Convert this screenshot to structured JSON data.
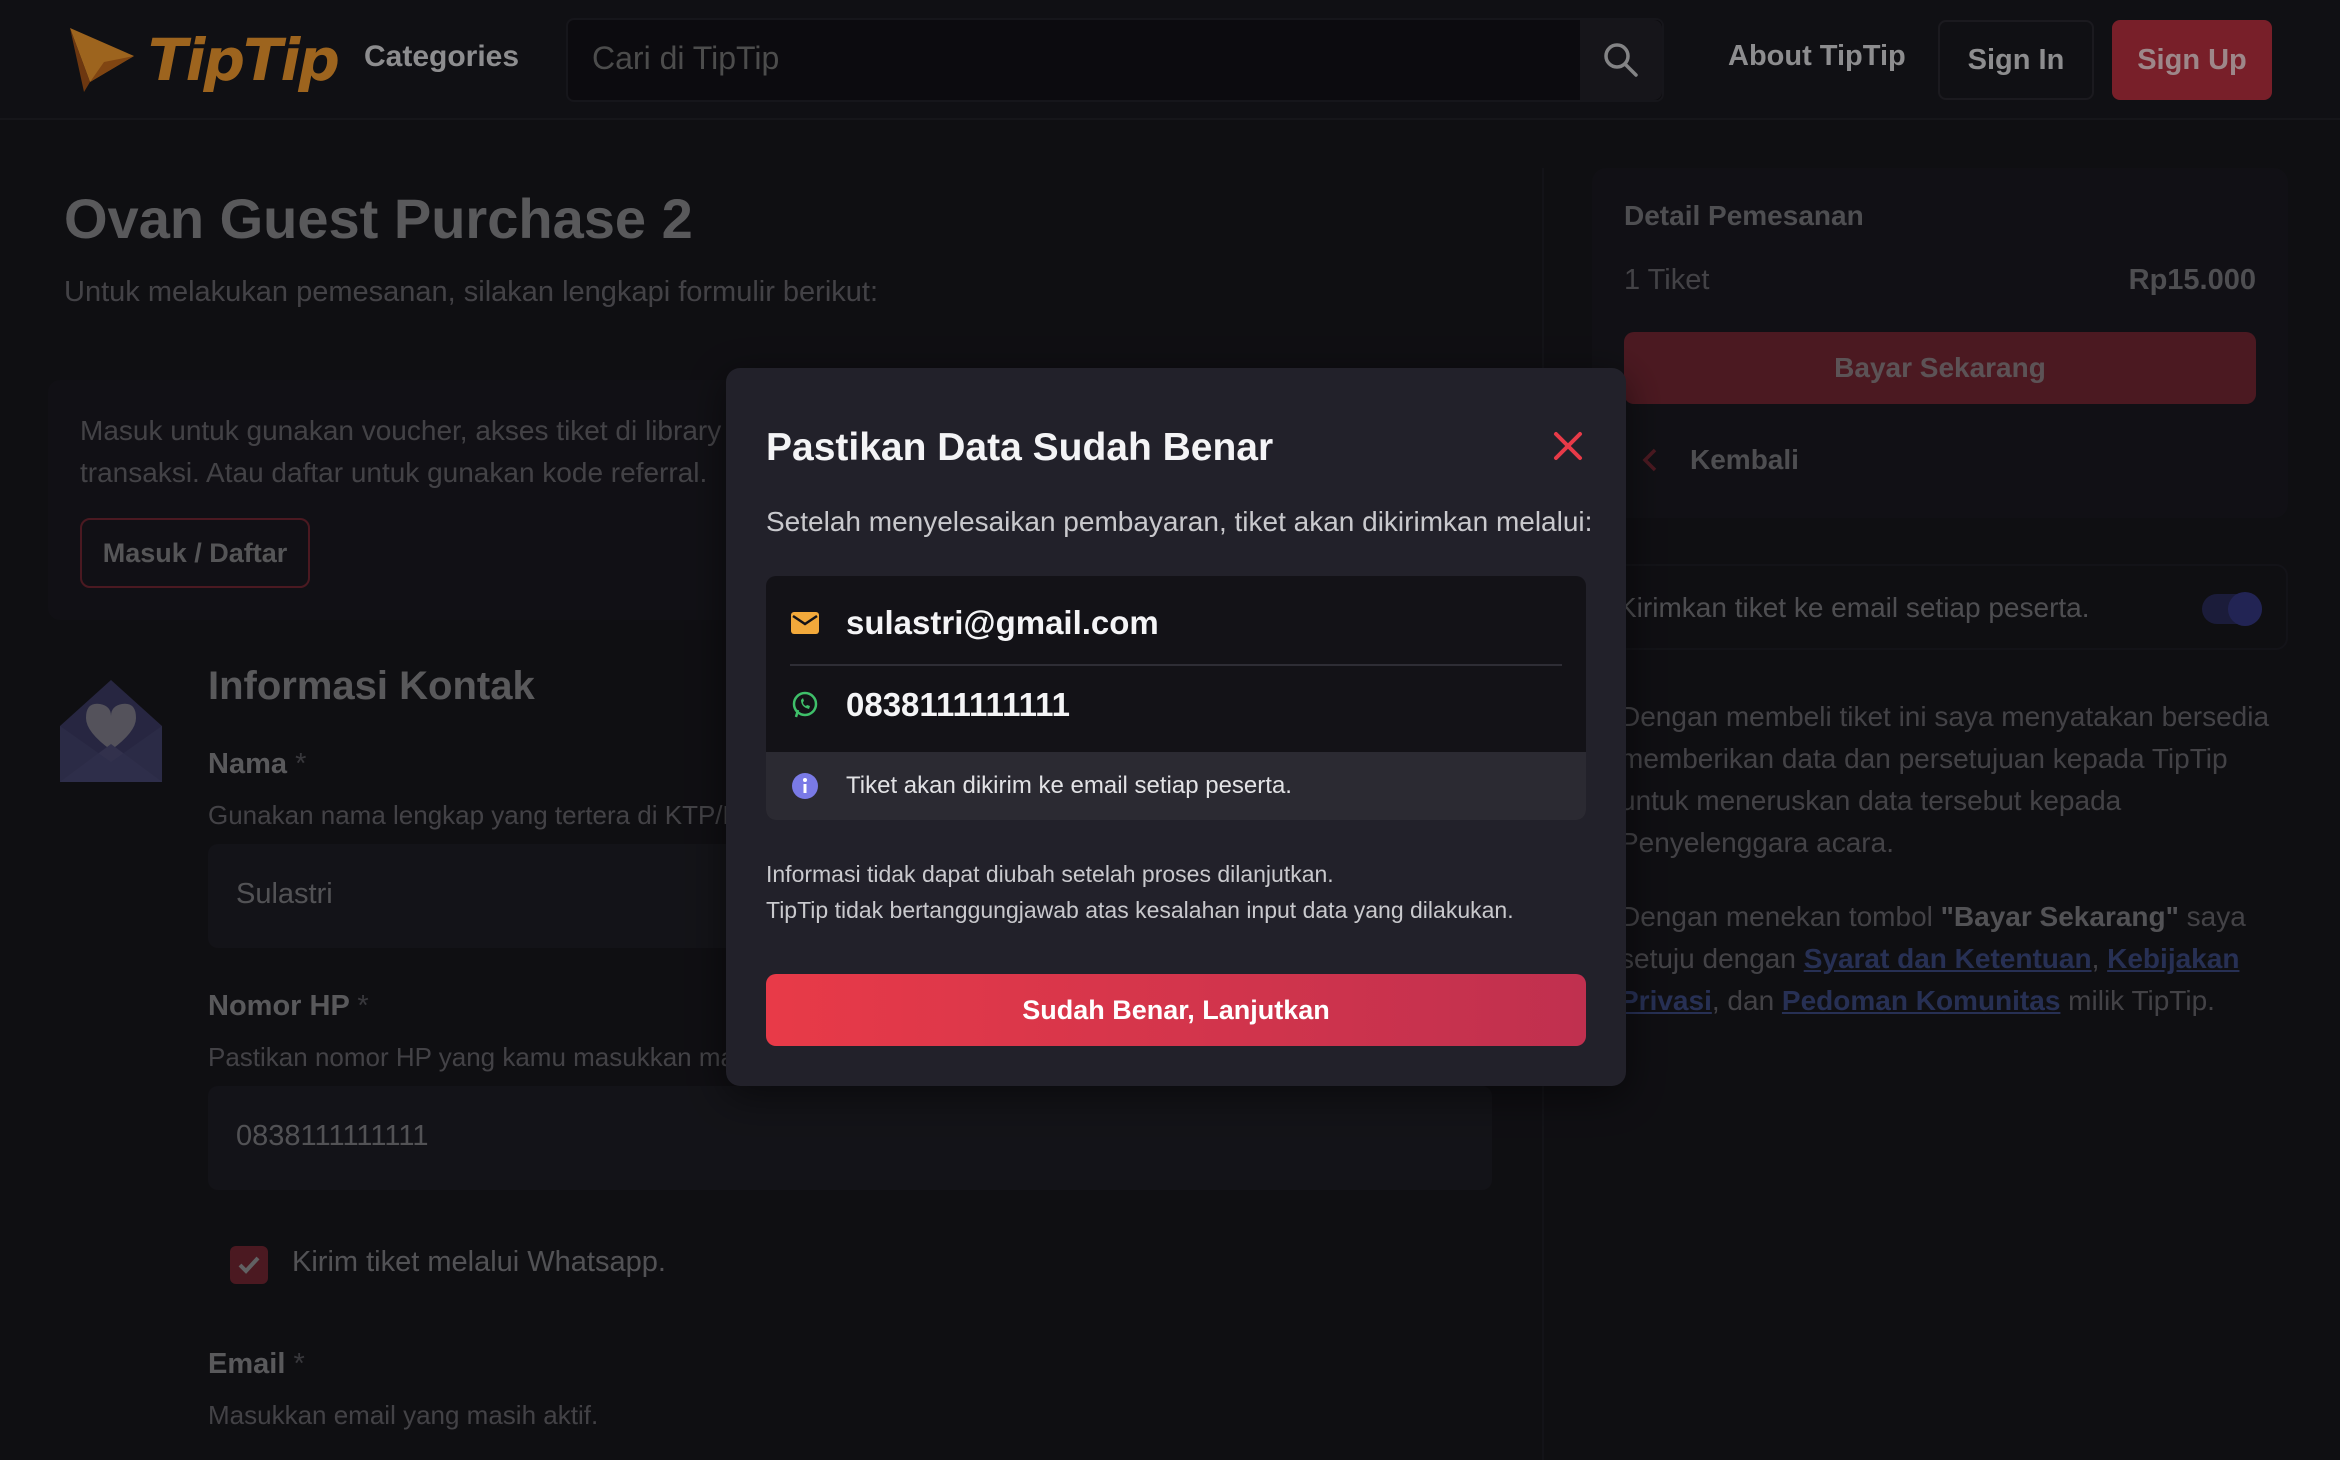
{
  "header": {
    "brand": "TipTip",
    "categories_label": "Categories",
    "search_placeholder": "Cari di TipTip",
    "about_label": "About TipTip",
    "signin_label": "Sign In",
    "signup_label": "Sign Up"
  },
  "main": {
    "title": "Ovan Guest Purchase 2",
    "subtitle": "Untuk melakukan pemesanan, silakan lengkapi formulir berikut:",
    "login_card": {
      "text": "Masuk untuk gunakan voucher, akses tiket di library transaksi. Atau daftar untuk gunakan kode referral.",
      "button_label": "Masuk / Daftar"
    },
    "contact": {
      "section_title": "Informasi Kontak",
      "name_label": "Nama",
      "required_mark": "*",
      "name_hint": "Gunakan nama lengkap yang tertera di KTP/Paspor",
      "name_value": "Sulastri",
      "phone_label": "Nomor HP",
      "phone_hint": "Pastikan nomor HP yang kamu masukkan masih aktif",
      "phone_value": "0838111111111",
      "whatsapp_checkbox_label": "Kirim tiket melalui Whatsapp.",
      "email_label": "Email",
      "email_hint": "Masukkan email yang masih aktif."
    }
  },
  "order": {
    "title": "Detail Pemesanan",
    "quantity": "1 Tiket",
    "price": "Rp15.000",
    "pay_button": "Bayar Sekarang",
    "back_label": "Kembali",
    "toggle_label": "Kirimkan tiket ke email setiap peserta.",
    "terms_1": "Dengan membeli tiket ini saya menyatakan bersedia memberikan data dan persetujuan kepada TipTip untuk meneruskan data tersebut kepada Penyelenggara acara.",
    "terms_2_prefix": "Dengan menekan tombol ",
    "terms_2_bold": "\"Bayar Sekarang\"",
    "terms_2_mid": " saya setuju dengan ",
    "link_terms": "Syarat dan Ketentuan",
    "comma": ", ",
    "link_privacy": "Kebijakan Privasi",
    "and": ", dan ",
    "link_community": "Pedoman Komunitas",
    "terms_2_suffix": " milik TipTip."
  },
  "modal": {
    "title": "Pastikan Data Sudah Benar",
    "subtitle": "Setelah menyelesaikan pembayaran, tiket akan dikirimkan melalui:",
    "email": "sulastri@gmail.com",
    "phone": "0838111111111",
    "info": "Tiket akan dikirim ke email setiap peserta.",
    "note_line1": "Informasi tidak dapat diubah setelah proses dilanjutkan.",
    "note_line2": "TipTip tidak bertanggungjawab atas kesalahan input data yang dilakukan.",
    "confirm_button": "Sudah Benar, Lanjutkan"
  },
  "colors": {
    "accent": "#e83a48",
    "brand_orange": "#f29a2e",
    "background": "#18171d",
    "modal_bg": "#22212a"
  }
}
